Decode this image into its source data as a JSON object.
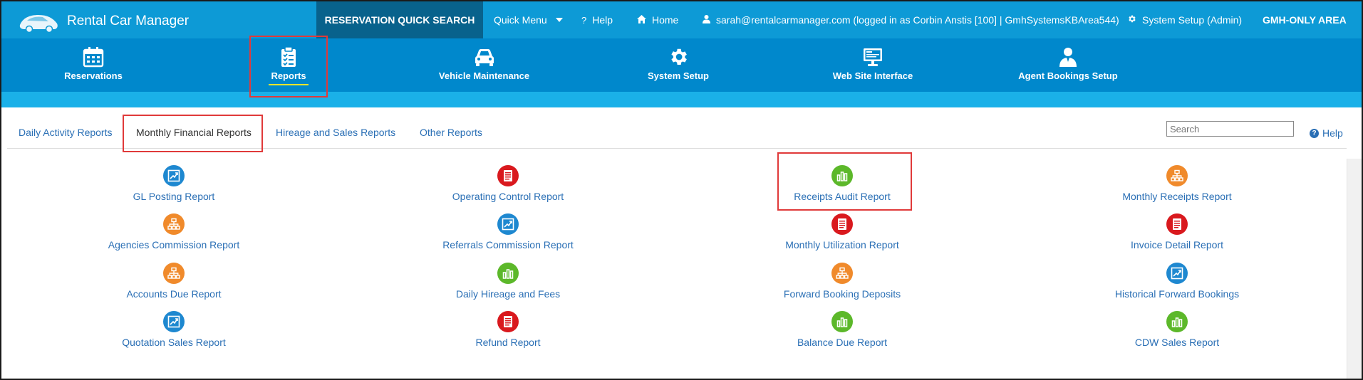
{
  "app": {
    "title": "Rental Car Manager"
  },
  "topnav": {
    "quick_search": "RESERVATION QUICK SEARCH",
    "quick_menu": "Quick Menu",
    "help": "Help",
    "home": "Home",
    "user": "sarah@rentalcarmanager.com (logged in as Corbin Anstis [100] | GmhSystemsKBArea544)",
    "system_setup": "System Setup (Admin)",
    "gmh_area": "GMH-ONLY AREA"
  },
  "modules": [
    {
      "label": "Reservations",
      "icon": "calendar-icon"
    },
    {
      "label": "Reports",
      "icon": "clipboard-checklist-icon",
      "active": true
    },
    {
      "label": "Vehicle Maintenance",
      "icon": "car-icon"
    },
    {
      "label": "System Setup",
      "icon": "gear-icon"
    },
    {
      "label": "Web Site Interface",
      "icon": "monitor-icon"
    },
    {
      "label": "Agent Bookings Setup",
      "icon": "agent-icon"
    }
  ],
  "tabs": [
    {
      "label": "Daily Activity Reports"
    },
    {
      "label": "Monthly Financial Reports",
      "active": true
    },
    {
      "label": "Hireage and Sales Reports"
    },
    {
      "label": "Other Reports"
    }
  ],
  "search": {
    "placeholder": "Search"
  },
  "help_link": "Help",
  "reports": [
    {
      "label": "GL Posting Report",
      "icon": "chart-line-icon",
      "color": "#1e88d0"
    },
    {
      "label": "Operating Control Report",
      "icon": "document-icon",
      "color": "#d9191e"
    },
    {
      "label": "Receipts Audit Report",
      "icon": "bar-chart-icon",
      "color": "#5cb82a"
    },
    {
      "label": "Monthly Receipts Report",
      "icon": "org-chart-icon",
      "color": "#f08a2b"
    },
    {
      "label": "Agencies Commission Report",
      "icon": "org-chart-icon",
      "color": "#f08a2b"
    },
    {
      "label": "Referrals Commission Report",
      "icon": "chart-line-icon",
      "color": "#1e88d0"
    },
    {
      "label": "Monthly Utilization Report",
      "icon": "document-icon",
      "color": "#d9191e"
    },
    {
      "label": "Invoice Detail Report",
      "icon": "document-icon",
      "color": "#d9191e"
    },
    {
      "label": "Accounts Due Report",
      "icon": "org-chart-icon",
      "color": "#f08a2b"
    },
    {
      "label": "Daily Hireage and Fees",
      "icon": "bar-chart-icon",
      "color": "#5cb82a"
    },
    {
      "label": "Forward Booking Deposits",
      "icon": "org-chart-icon",
      "color": "#f08a2b"
    },
    {
      "label": "Historical Forward Bookings",
      "icon": "chart-line-icon",
      "color": "#1e88d0"
    },
    {
      "label": "Quotation Sales Report",
      "icon": "chart-line-icon",
      "color": "#1e88d0"
    },
    {
      "label": "Refund Report",
      "icon": "document-icon",
      "color": "#d9191e"
    },
    {
      "label": "Balance Due Report",
      "icon": "bar-chart-icon",
      "color": "#5cb82a"
    },
    {
      "label": "CDW Sales Report",
      "icon": "bar-chart-icon",
      "color": "#5cb82a"
    }
  ]
}
